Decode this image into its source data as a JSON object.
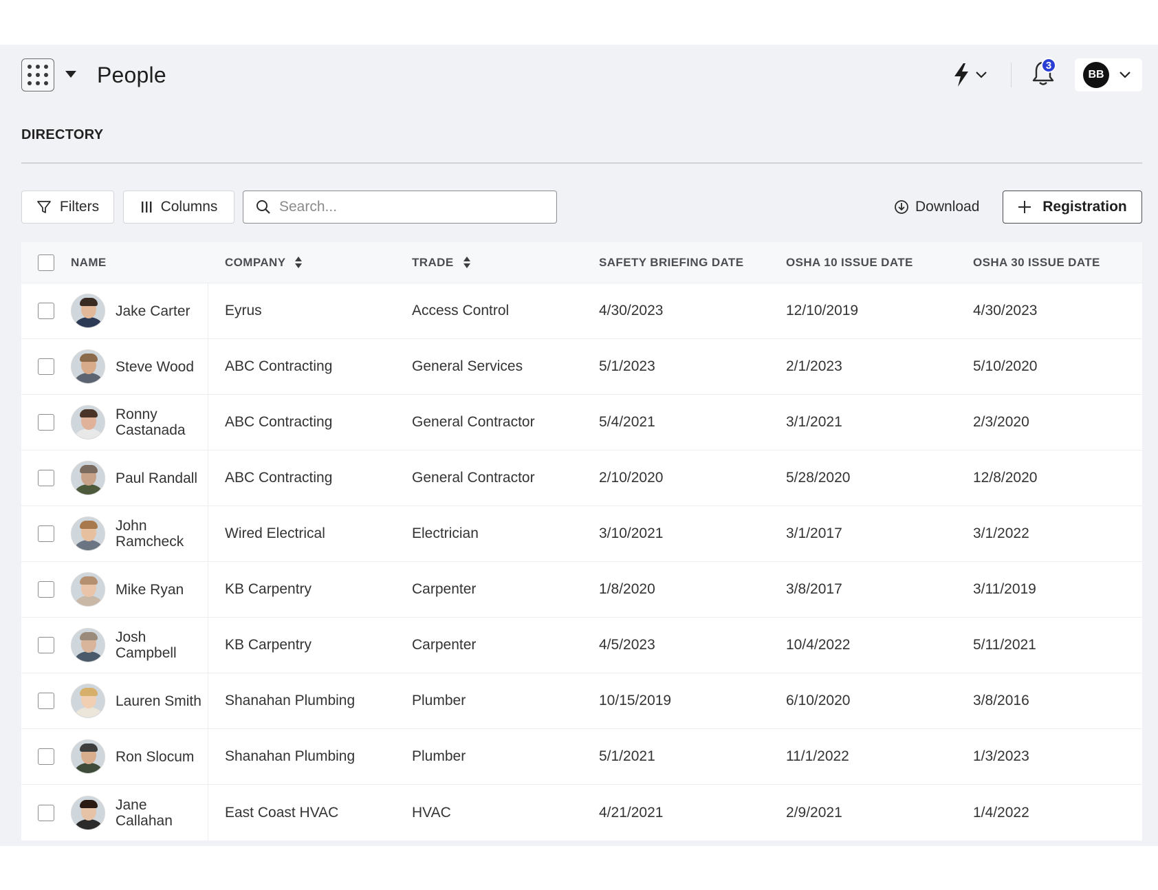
{
  "header": {
    "title": "People",
    "notification_count": "3",
    "user_initials": "BB"
  },
  "section": {
    "title": "DIRECTORY"
  },
  "toolbar": {
    "filters_label": "Filters",
    "columns_label": "Columns",
    "search_placeholder": "Search...",
    "download_label": "Download",
    "registration_label": "Registration"
  },
  "table": {
    "columns": {
      "name": "NAME",
      "company": "COMPANY",
      "trade": "TRADE",
      "safety_briefing": "SAFETY BRIEFING DATE",
      "osha10": "OSHA 10 ISSUE DATE",
      "osha30": "OSHA 30 ISSUE DATE"
    },
    "rows": [
      {
        "name": "Jake Carter",
        "company": "Eyrus",
        "trade": "Access Control",
        "safety_briefing": "4/30/2023",
        "osha10": "12/10/2019",
        "osha30": "4/30/2023",
        "skin": "#e2b89a",
        "hair": "#3a2b22",
        "shirt": "#2d3a55"
      },
      {
        "name": "Steve Wood",
        "company": "ABC Contracting",
        "trade": "General Services",
        "safety_briefing": "5/1/2023",
        "osha10": "2/1/2023",
        "osha30": "5/10/2020",
        "skin": "#d8ab8a",
        "hair": "#8a6a4a",
        "shirt": "#5b6470"
      },
      {
        "name": "Ronny Castanada",
        "company": "ABC Contracting",
        "trade": "General Contractor",
        "safety_briefing": "5/4/2021",
        "osha10": "3/1/2021",
        "osha30": "2/3/2020",
        "skin": "#e0b299",
        "hair": "#4a3428",
        "shirt": "#e8e8e8"
      },
      {
        "name": "Paul Randall",
        "company": "ABC Contracting",
        "trade": "General Contractor",
        "safety_briefing": "2/10/2020",
        "osha10": "5/28/2020",
        "osha30": "12/8/2020",
        "skin": "#c9a28a",
        "hair": "#7b6a5e",
        "shirt": "#4d5a3c"
      },
      {
        "name": "John Ramcheck",
        "company": "Wired Electrical",
        "trade": "Electrician",
        "safety_briefing": "3/10/2021",
        "osha10": "3/1/2017",
        "osha30": "3/1/2022",
        "skin": "#e7c0a0",
        "hair": "#a8794c",
        "shirt": "#6a7482"
      },
      {
        "name": "Mike Ryan",
        "company": "KB Carpentry",
        "trade": "Carpenter",
        "safety_briefing": "1/8/2020",
        "osha10": "3/8/2017",
        "osha30": "3/11/2019",
        "skin": "#e9c4a9",
        "hair": "#b49070",
        "shirt": "#c9b8a6"
      },
      {
        "name": "Josh Campbell",
        "company": "KB Carpentry",
        "trade": "Carpenter",
        "safety_briefing": "4/5/2023",
        "osha10": "10/4/2022",
        "osha30": "5/11/2021",
        "skin": "#d9b59c",
        "hair": "#9a8b7a",
        "shirt": "#4a5a6a"
      },
      {
        "name": "Lauren Smith",
        "company": "Shanahan Plumbing",
        "trade": "Plumber",
        "safety_briefing": "10/15/2019",
        "osha10": "6/10/2020",
        "osha30": "3/8/2016",
        "skin": "#f0cfb3",
        "hair": "#d6b06a",
        "shirt": "#ece5da"
      },
      {
        "name": "Ron Slocum",
        "company": "Shanahan Plumbing",
        "trade": "Plumber",
        "safety_briefing": "5/1/2021",
        "osha10": "11/1/2022",
        "osha30": "1/3/2023",
        "skin": "#d9ae8e",
        "hair": "#3d3d3d",
        "shirt": "#3f4b3a"
      },
      {
        "name": "Jane Callahan",
        "company": "East Coast HVAC",
        "trade": "HVAC",
        "safety_briefing": "4/21/2021",
        "osha10": "2/9/2021",
        "osha30": "1/4/2022",
        "skin": "#e6c2a6",
        "hair": "#2a1c15",
        "shirt": "#2b2b2b"
      }
    ]
  },
  "colors": {
    "background": "#f1f2f5",
    "badge": "#2a3ed6",
    "avatar_bg": "#111111"
  }
}
